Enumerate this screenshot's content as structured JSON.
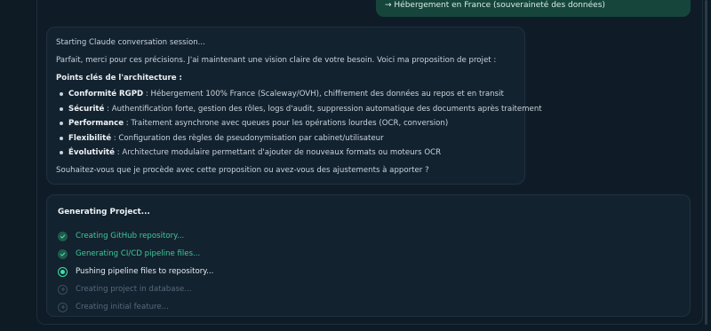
{
  "user_message": "→ Hébergement en France (souveraineté des données)",
  "assistant": {
    "session_text": "Starting Claude conversation session...",
    "intro": "Parfait, merci pour ces précisions. J'ai maintenant une vision claire de votre besoin. Voici ma proposition de projet :",
    "section_heading": "Points clés de l'architecture :",
    "points": [
      {
        "term": "Conformité RGPD",
        "desc": " : Hébergement 100% France (Scaleway/OVH), chiffrement des données au repos et en transit"
      },
      {
        "term": "Sécurité",
        "desc": " : Authentification forte, gestion des rôles, logs d'audit, suppression automatique des documents après traitement"
      },
      {
        "term": "Performance",
        "desc": " : Traitement asynchrone avec queues pour les opérations lourdes (OCR, conversion)"
      },
      {
        "term": "Flexibilité",
        "desc": " : Configuration des règles de pseudonymisation par cabinet/utilisateur"
      },
      {
        "term": "Évolutivité",
        "desc": " : Architecture modulaire permettant d'ajouter de nouveaux formats ou moteurs OCR"
      }
    ],
    "question": "Souhaitez-vous que je procède avec cette proposition ou avez-vous des ajustements à apporter ?"
  },
  "progress": {
    "title": "Generating Project...",
    "steps": [
      {
        "label": "Creating GitHub repository...",
        "status": "done"
      },
      {
        "label": "Generating CI/CD pipeline files...",
        "status": "done"
      },
      {
        "label": "Pushing pipeline files to repository...",
        "status": "active"
      },
      {
        "label": "Creating project in database...",
        "status": "pending"
      },
      {
        "label": "Creating initial feature...",
        "status": "pending"
      }
    ]
  },
  "colors": {
    "background": "#0e1a24",
    "card": "#13222f",
    "accent_green": "#3ec99a",
    "user_bubble": "#16453b"
  }
}
